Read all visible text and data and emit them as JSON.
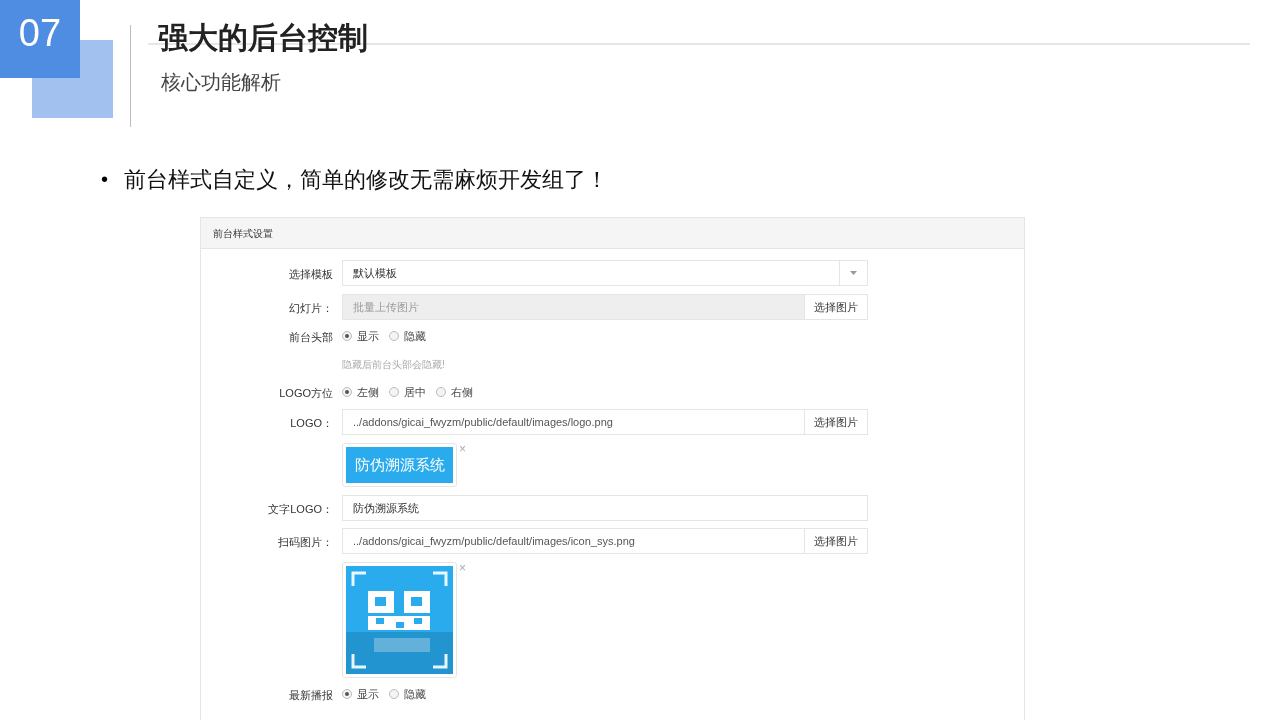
{
  "slide": {
    "number": "07",
    "title": "强大的后台控制",
    "subtitle": "核心功能解析",
    "bullet_marker": "•",
    "bullet": "前台样式自定义，简单的修改无需麻烦开发组了！"
  },
  "panel": {
    "title": "前台样式设置",
    "rows": [
      {
        "kind": "select",
        "label": "选择模板",
        "value": "默认模板"
      },
      {
        "kind": "file",
        "label": "幻灯片：",
        "placeholder": "批量上传图片",
        "disabled": true,
        "button": "选择图片"
      },
      {
        "kind": "radio",
        "label": "前台头部",
        "options": [
          {
            "label": "显示",
            "selected": true
          },
          {
            "label": "隐藏",
            "selected": false
          }
        ],
        "help": "隐藏后前台头部会隐藏!"
      },
      {
        "kind": "radio",
        "label": "LOGO方位",
        "options": [
          {
            "label": "左侧",
            "selected": true
          },
          {
            "label": "居中",
            "selected": false
          },
          {
            "label": "右侧",
            "selected": false
          }
        ]
      },
      {
        "kind": "file",
        "label": "LOGO：",
        "value": "../addons/gicai_fwyzm/public/default/images/logo.png",
        "disabled": false,
        "button": "选择图片"
      },
      {
        "kind": "logo_preview",
        "text": "防伪溯源系统",
        "close": "×"
      },
      {
        "kind": "text",
        "label": "文字LOGO：",
        "value": "防伪溯源系统"
      },
      {
        "kind": "file",
        "label": "扫码图片：",
        "value": "../addons/gicai_fwyzm/public/default/images/icon_sys.png",
        "disabled": false,
        "button": "选择图片"
      },
      {
        "kind": "qr_preview",
        "close": "×"
      },
      {
        "kind": "radio",
        "label": "最新播报",
        "options": [
          {
            "label": "显示",
            "selected": true
          },
          {
            "label": "隐藏",
            "selected": false
          }
        ]
      }
    ]
  }
}
